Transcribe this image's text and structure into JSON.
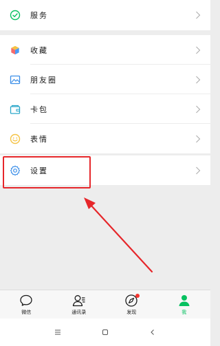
{
  "menu": {
    "service_label": "服务",
    "favorites_label": "收藏",
    "moments_label": "朋友圈",
    "cards_label": "卡包",
    "stickers_label": "表情",
    "settings_label": "设置"
  },
  "tabs": [
    {
      "label": "微信"
    },
    {
      "label": "通讯录"
    },
    {
      "label": "发现"
    },
    {
      "label": "我"
    }
  ],
  "colors": {
    "accent_green": "#07c160",
    "highlight_red": "#e6262a",
    "badge_red": "#f43530"
  }
}
